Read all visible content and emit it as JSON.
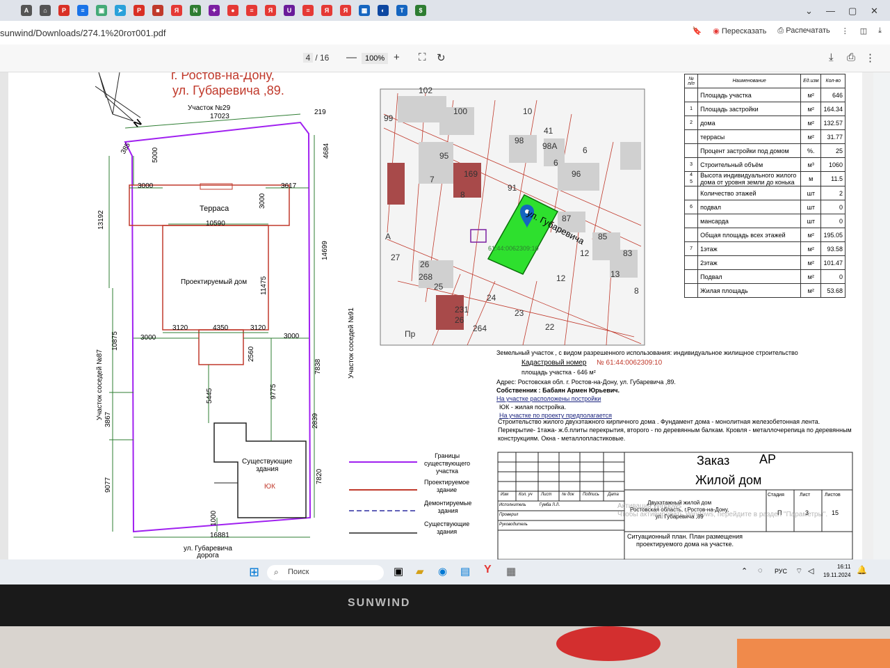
{
  "browser": {
    "url": "sunwind/Downloads/274.1%20гот001.pdf",
    "retell_label": "Пересказать",
    "print_label": "Распечатать",
    "tabs": [
      {
        "icon": "a-icon",
        "color": "#555"
      },
      {
        "icon": "home-icon",
        "color": "#555"
      },
      {
        "icon": "pdf-icon",
        "color": "#d93025"
      },
      {
        "icon": "doc-icon",
        "color": "#1a73e8"
      },
      {
        "icon": "image-icon",
        "color": "#4a7"
      },
      {
        "icon": "telegram-icon",
        "color": "#2aa1da"
      },
      {
        "icon": "pdf-icon",
        "color": "#d93025"
      },
      {
        "icon": "red-icon",
        "color": "#c0392b"
      },
      {
        "icon": "ya-icon",
        "color": "#e53935"
      },
      {
        "icon": "n-icon",
        "color": "#2e7d32"
      },
      {
        "icon": "star-icon",
        "color": "#7b1fa2"
      },
      {
        "icon": "pin-icon",
        "color": "#e53935"
      },
      {
        "icon": "doc-icon",
        "color": "#e53935"
      },
      {
        "icon": "ya-icon",
        "color": "#e53935"
      },
      {
        "icon": "magnet-icon",
        "color": "#6a1b9a"
      },
      {
        "icon": "doc-icon",
        "color": "#e53935"
      },
      {
        "icon": "ya-icon",
        "color": "#e53935"
      },
      {
        "icon": "ya-icon",
        "color": "#e53935"
      },
      {
        "icon": "grid-icon",
        "color": "#1565c0"
      },
      {
        "icon": "edge-icon",
        "color": "#0d47a1"
      },
      {
        "icon": "t-icon",
        "color": "#1565c0"
      },
      {
        "icon": "dollar-icon",
        "color": "#2e7d32"
      }
    ]
  },
  "pdf": {
    "page_current": "4",
    "page_total": "/ 16",
    "zoom": "100%"
  },
  "drawing": {
    "city": "г. Ростов-на-Дону,",
    "street": "ул. Губаревича ,89.",
    "plot_north": "Участок №29",
    "neighbor_left": "Участок соседей №87",
    "neighbor_right": "Участок соседей №91",
    "road": "ул. Губаревича\nдорога",
    "terrace": "Терраса",
    "house": "Проектируемый дом",
    "existing": "Существующие\nздания",
    "yk": "ЮК",
    "north": "N",
    "dims": {
      "top": "17023",
      "corner": "219",
      "bottom": "16881",
      "d5000": "5000",
      "d3000a": "3000",
      "d3617": "3617",
      "d10590": "10590",
      "d3000v": "3000",
      "d11475": "11475",
      "d3120a": "3120",
      "d4350": "4350",
      "d3120b": "3120",
      "d3000b": "3000",
      "d3000c": "3000",
      "d2560": "2560",
      "d5445": "5445",
      "d9775": "9775",
      "d13192": "13192",
      "d10875": "10875",
      "d3867": "3867",
      "d9077": "9077",
      "d4684": "4684",
      "d14699": "14699",
      "d7838": "7838",
      "d2839": "2839",
      "d7820": "7820",
      "d1000": "1000",
      "d385": "385"
    }
  },
  "legend": [
    {
      "label": "Границы\nсуществующего\nучастка",
      "color": "#a020f0",
      "style": "solid"
    },
    {
      "label": "Проектируемое\nздание",
      "color": "#c0392b",
      "style": "solid"
    },
    {
      "label": "Демонтируемые\nздания",
      "color": "#2c2ca0",
      "style": "dashed"
    },
    {
      "label": "Существующие\nздания",
      "color": "#222",
      "style": "solid"
    }
  ],
  "map": {
    "street": "ул. Губаревича",
    "cadastral": "61:44:0062309:10",
    "numbers": [
      "102",
      "100",
      "99",
      "10",
      "98",
      "41",
      "98А",
      "6",
      "95",
      "169",
      "96",
      "91",
      "7",
      "8",
      "6",
      "87",
      "85",
      "83",
      "12",
      "13",
      "27",
      "26",
      "268",
      "25",
      "231",
      "26",
      "24",
      "23",
      "264",
      "22",
      "12",
      "8",
      "А",
      "Пр"
    ]
  },
  "spec_table": {
    "headers": [
      "№ п/п",
      "Наименование",
      "Ед.изм",
      "Кол-во"
    ],
    "rows": [
      {
        "n": "",
        "name": "Площадь участка",
        "unit": "м²",
        "qty": "646"
      },
      {
        "n": "1",
        "name": "Площадь застройки",
        "unit": "м²",
        "qty": "164.34"
      },
      {
        "n": "2",
        "name": "дома",
        "unit": "м²",
        "qty": "132.57"
      },
      {
        "n": "",
        "name": "террасы",
        "unit": "м²",
        "qty": "31.77"
      },
      {
        "n": "",
        "name": "Процент застройки под домом",
        "unit": "%.",
        "qty": "25"
      },
      {
        "n": "3",
        "name": "Строительный объём",
        "unit": "м³",
        "qty": "1060"
      },
      {
        "n": "4\n5",
        "name": "Высота индивидуального жилого дома от уровня земли до конька",
        "unit": "м",
        "qty": "11.5"
      },
      {
        "n": "",
        "name": "Количество этажей",
        "unit": "шт",
        "qty": "2"
      },
      {
        "n": "6",
        "name": "подвал",
        "unit": "шт",
        "qty": "0"
      },
      {
        "n": "",
        "name": "мансарда",
        "unit": "шт",
        "qty": "0"
      },
      {
        "n": "",
        "name": "Общая площадь всех этажей",
        "unit": "м²",
        "qty": "195.05"
      },
      {
        "n": "7",
        "name": "1этаж",
        "unit": "м²",
        "qty": "93.58"
      },
      {
        "n": "",
        "name": "2этаж",
        "unit": "м²",
        "qty": "101.47"
      },
      {
        "n": "",
        "name": "Подвал",
        "unit": "м²",
        "qty": "0"
      },
      {
        "n": "",
        "name": "Жилая площадь",
        "unit": "м²",
        "qty": "53.68"
      }
    ]
  },
  "notes": {
    "line1": "Земельный участок , с видом разрешенного использования: индивидуальное жилищное строительство",
    "cad_label": "Кадастровый номер",
    "cad_value": "№ 61:44:0062309:10",
    "area": "площадь участка - 646 м²",
    "address": "Адрес: Ростовская обл. г. Ростов-на-Дону, ул. Губаревича ,89.",
    "owner": "Собственник : Бабаян Армен Юрьевич.",
    "existing_header": "На участке расположены постройки",
    "existing_item": "ЮК - жилая постройка.",
    "planned_header": "На участке по проекту предполагается",
    "desc": "Строительство жилого двухэтажного кирпичного дома . Фундамент дома - монолитная железобетонная лента. Перекрытие- 1тажа- ж.б.плиты перекрытия, второго - по деревянным балкам. Кровля - металлочерепица по деревянным конструкциям. Окна - металлопластиковые."
  },
  "stamp": {
    "order": "Заказ",
    "section": "АР",
    "title": "Жилой дом",
    "object": "Двухэтажный жилой дом\nРостовская область, г.Ростов-на-Дону,\nул. Губаревича ,89",
    "sheet_title": "Ситуационный план. План размещения\nпроектируемого дома на участке.",
    "cols": [
      "Изм",
      "Кол. уч",
      "Лист",
      "№ док",
      "Подпись",
      "Дата"
    ],
    "roles": [
      "Исполнитель",
      "Проверил",
      "Руководитель"
    ],
    "executor": "Гумба Л.Л.",
    "stage_label": "Стадия",
    "sheet_label": "Лист",
    "sheets_label": "Листов",
    "stage": "П",
    "sheet": "3",
    "sheets": "15",
    "activation": "Активация Windows\nЧтобы активировать Windows, перейдите в раздел \"Параметры\"."
  },
  "taskbar": {
    "search": "Поиск",
    "lang": "РУС",
    "time": "16:11",
    "date": "19.11.2024"
  },
  "monitor": {
    "brand": "SUNWIND"
  }
}
